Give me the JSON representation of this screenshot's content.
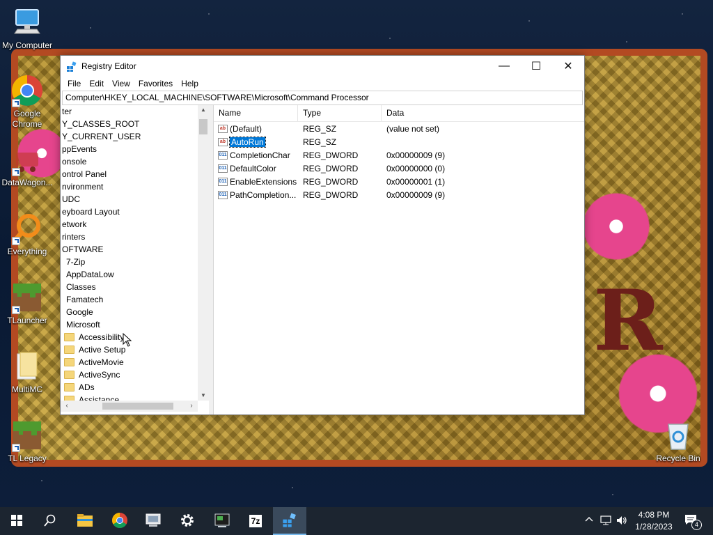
{
  "desktop": {
    "icons": [
      {
        "label": "My Computer",
        "icon": "computer-icon"
      },
      {
        "label": "Google Chrome",
        "label_line2": "Chrome",
        "label_line1": "Google",
        "icon": "chrome-icon"
      },
      {
        "label": "DataWagon...",
        "icon": "datawagon-icon"
      },
      {
        "label": "Everything",
        "icon": "everything-search-icon"
      },
      {
        "label": "TLauncher",
        "icon": "minecraft-grass-icon"
      },
      {
        "label": "MultiMC",
        "icon": "folder-icon"
      },
      {
        "label": "TL Legacy",
        "icon": "minecraft-grass-icon"
      },
      {
        "label": "Recycle Bin",
        "icon": "recycle-bin-icon"
      }
    ]
  },
  "window": {
    "title": "Registry Editor",
    "controls": {
      "minimize": "—",
      "maximize": "☐",
      "close": "✕"
    },
    "menu": [
      "File",
      "Edit",
      "View",
      "Favorites",
      "Help"
    ],
    "address": "Computer\\HKEY_LOCAL_MACHINE\\SOFTWARE\\Microsoft\\Command Processor",
    "tree": [
      {
        "label": "ter",
        "level": 0,
        "folder": false
      },
      {
        "label": "Y_CLASSES_ROOT",
        "level": 0,
        "folder": false
      },
      {
        "label": "Y_CURRENT_USER",
        "level": 0,
        "folder": false
      },
      {
        "label": "ppEvents",
        "level": 0,
        "folder": false
      },
      {
        "label": "onsole",
        "level": 0,
        "folder": false
      },
      {
        "label": "ontrol Panel",
        "level": 0,
        "folder": false
      },
      {
        "label": "nvironment",
        "level": 0,
        "folder": false
      },
      {
        "label": "UDC",
        "level": 0,
        "folder": false
      },
      {
        "label": "eyboard Layout",
        "level": 0,
        "folder": false
      },
      {
        "label": "etwork",
        "level": 0,
        "folder": false
      },
      {
        "label": "rinters",
        "level": 0,
        "folder": false
      },
      {
        "label": "OFTWARE",
        "level": 0,
        "folder": false
      },
      {
        "label": "7-Zip",
        "level": 1,
        "folder": false
      },
      {
        "label": "AppDataLow",
        "level": 1,
        "folder": false
      },
      {
        "label": "Classes",
        "level": 1,
        "folder": false
      },
      {
        "label": "Famatech",
        "level": 1,
        "folder": false
      },
      {
        "label": "Google",
        "level": 1,
        "folder": false
      },
      {
        "label": "Microsoft",
        "level": 1,
        "folder": false
      },
      {
        "label": "Accessibility",
        "level": 2,
        "folder": true
      },
      {
        "label": "Active Setup",
        "level": 2,
        "folder": true
      },
      {
        "label": "ActiveMovie",
        "level": 2,
        "folder": true
      },
      {
        "label": "ActiveSync",
        "level": 2,
        "folder": true
      },
      {
        "label": "ADs",
        "level": 2,
        "folder": true
      },
      {
        "label": "Assistance",
        "level": 2,
        "folder": true
      }
    ],
    "columns": {
      "name": "Name",
      "type": "Type",
      "data": "Data"
    },
    "values": [
      {
        "name": "(Default)",
        "type": "REG_SZ",
        "data": "(value not set)",
        "kind": "sz",
        "icon_text": "ab"
      },
      {
        "name": "AutoRun",
        "type": "REG_SZ",
        "data": "",
        "kind": "sz",
        "icon_text": "ab",
        "selected": true
      },
      {
        "name": "CompletionChar",
        "type": "REG_DWORD",
        "data": "0x00000009 (9)",
        "kind": "dw",
        "icon_text": "011"
      },
      {
        "name": "DefaultColor",
        "type": "REG_DWORD",
        "data": "0x00000000 (0)",
        "kind": "dw",
        "icon_text": "011"
      },
      {
        "name": "EnableExtensions",
        "type": "REG_DWORD",
        "data": "0x00000001 (1)",
        "kind": "dw",
        "icon_text": "011"
      },
      {
        "name": "PathCompletion...",
        "type": "REG_DWORD",
        "data": "0x00000009 (9)",
        "kind": "dw",
        "icon_text": "011"
      }
    ]
  },
  "taskbar": {
    "items": [
      "windows-start-icon",
      "search-icon",
      "file-explorer-icon",
      "chrome-icon",
      "network-tool-icon",
      "settings-gear-icon",
      "terminal-icon",
      "7zip-icon",
      "registry-editor-icon"
    ],
    "sevenzip_label": "7z",
    "time": "4:08 PM",
    "date": "1/28/2023",
    "notification_count": "4"
  },
  "colors": {
    "accent": "#0078d7",
    "taskbar": "#1c2530"
  }
}
